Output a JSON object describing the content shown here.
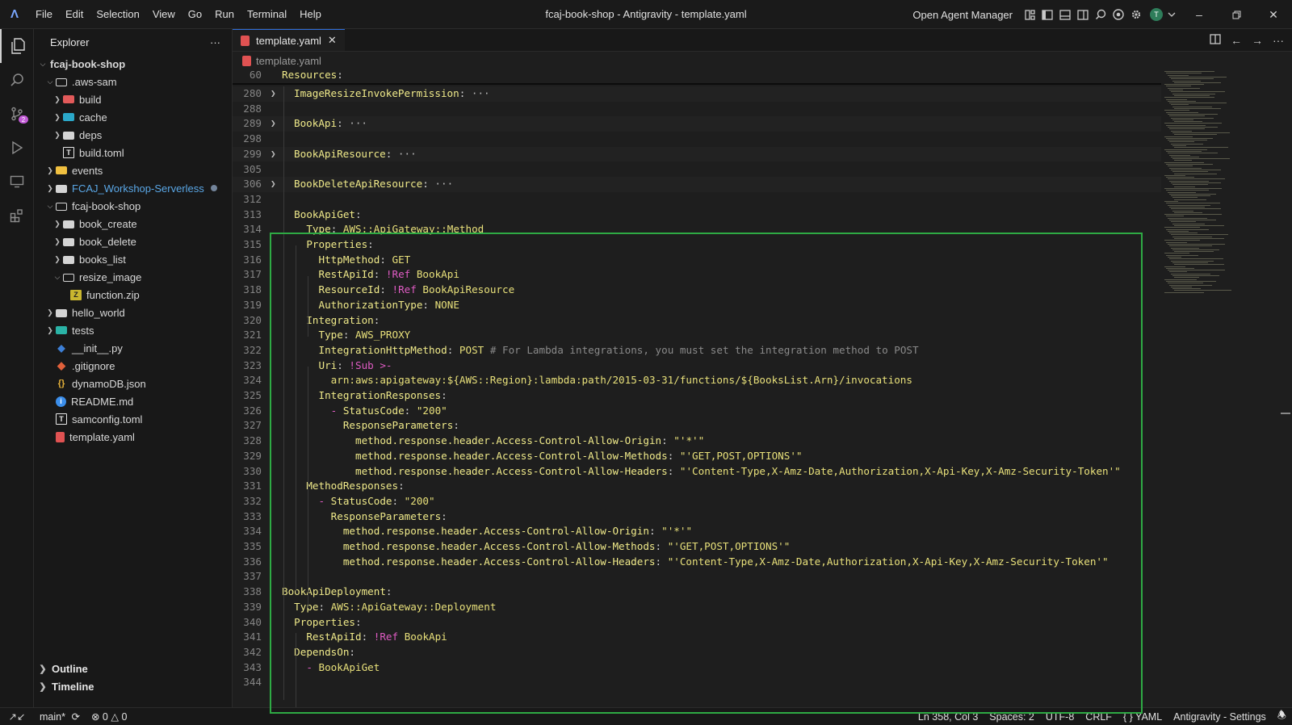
{
  "titlebar": {
    "menu": [
      "File",
      "Edit",
      "Selection",
      "View",
      "Go",
      "Run",
      "Terminal",
      "Help"
    ],
    "window_title": "fcaj-book-shop - Antigravity - template.yaml",
    "agent_manager": "Open Agent Manager",
    "avatar_initial": "T"
  },
  "activitybar": {
    "scm_badge": "2"
  },
  "sidebar": {
    "title": "Explorer",
    "more": "···",
    "tree": [
      {
        "label": "fcaj-book-shop",
        "depth": 0,
        "chevron": "open",
        "icon": "none",
        "bold": true
      },
      {
        "label": ".aws-sam",
        "depth": 1,
        "chevron": "open",
        "icon": "folder-open"
      },
      {
        "label": "build",
        "depth": 2,
        "chevron": "closed",
        "icon": "folder-build"
      },
      {
        "label": "cache",
        "depth": 2,
        "chevron": "closed",
        "icon": "folder-cache"
      },
      {
        "label": "deps",
        "depth": 2,
        "chevron": "closed",
        "icon": "folder"
      },
      {
        "label": "build.toml",
        "depth": 2,
        "chevron": "none",
        "icon": "toml"
      },
      {
        "label": "events",
        "depth": 1,
        "chevron": "closed",
        "icon": "folder-events"
      },
      {
        "label": "FCAJ_Workshop-Serverless",
        "depth": 1,
        "chevron": "closed",
        "icon": "folder",
        "color": "#5aa7e6",
        "dot": true
      },
      {
        "label": "fcaj-book-shop",
        "depth": 1,
        "chevron": "open",
        "icon": "folder-open"
      },
      {
        "label": "book_create",
        "depth": 2,
        "chevron": "closed",
        "icon": "folder"
      },
      {
        "label": "book_delete",
        "depth": 2,
        "chevron": "closed",
        "icon": "folder"
      },
      {
        "label": "books_list",
        "depth": 2,
        "chevron": "closed",
        "icon": "folder"
      },
      {
        "label": "resize_image",
        "depth": 2,
        "chevron": "open",
        "icon": "folder-open"
      },
      {
        "label": "function.zip",
        "depth": 3,
        "chevron": "none",
        "icon": "zip"
      },
      {
        "label": "hello_world",
        "depth": 1,
        "chevron": "closed",
        "icon": "folder"
      },
      {
        "label": "tests",
        "depth": 1,
        "chevron": "closed",
        "icon": "folder-tests"
      },
      {
        "label": "__init__.py",
        "depth": 1,
        "chevron": "none",
        "icon": "python"
      },
      {
        "label": ".gitignore",
        "depth": 1,
        "chevron": "none",
        "icon": "git"
      },
      {
        "label": "dynamoDB.json",
        "depth": 1,
        "chevron": "none",
        "icon": "json"
      },
      {
        "label": "README.md",
        "depth": 1,
        "chevron": "none",
        "icon": "info"
      },
      {
        "label": "samconfig.toml",
        "depth": 1,
        "chevron": "none",
        "icon": "toml"
      },
      {
        "label": "template.yaml",
        "depth": 1,
        "chevron": "none",
        "icon": "yaml"
      }
    ],
    "outline": "Outline",
    "timeline": "Timeline"
  },
  "editor": {
    "tab_label": "template.yaml",
    "breadcrumb": "template.yaml",
    "lines": [
      {
        "n": "60",
        "sticky": true,
        "tokens": [
          [
            "k",
            "Resources"
          ],
          [
            "p",
            ":"
          ]
        ]
      },
      {
        "n": "280",
        "folded": true,
        "tokens": [
          [
            "k",
            "ImageResizeInvokePermission"
          ],
          [
            "p",
            ":"
          ],
          [
            "dots",
            " ···"
          ]
        ]
      },
      {
        "n": "288",
        "tokens": []
      },
      {
        "n": "289",
        "folded": true,
        "tokens": [
          [
            "k",
            "BookApi"
          ],
          [
            "p",
            ":"
          ],
          [
            "dots",
            " ···"
          ]
        ]
      },
      {
        "n": "298",
        "tokens": []
      },
      {
        "n": "299",
        "folded": true,
        "tokens": [
          [
            "k",
            "BookApiResource"
          ],
          [
            "p",
            ":"
          ],
          [
            "dots",
            " ···"
          ]
        ]
      },
      {
        "n": "305",
        "tokens": []
      },
      {
        "n": "306",
        "folded": true,
        "tokens": [
          [
            "k",
            "BookDeleteApiResource"
          ],
          [
            "p",
            ":"
          ],
          [
            "dots",
            " ···"
          ]
        ]
      },
      {
        "n": "312",
        "tokens": []
      },
      {
        "n": "313",
        "tokens": [
          [
            "p",
            "  "
          ],
          [
            "k",
            "BookApiGet"
          ],
          [
            "p",
            ":"
          ]
        ]
      },
      {
        "n": "314",
        "tokens": [
          [
            "p",
            "    "
          ],
          [
            "k",
            "Type"
          ],
          [
            "p",
            ": "
          ],
          [
            "s",
            "AWS::ApiGateway::Method"
          ]
        ]
      },
      {
        "n": "315",
        "tokens": [
          [
            "p",
            "    "
          ],
          [
            "k",
            "Properties"
          ],
          [
            "p",
            ":"
          ]
        ]
      },
      {
        "n": "316",
        "tokens": [
          [
            "p",
            "      "
          ],
          [
            "k",
            "HttpMethod"
          ],
          [
            "p",
            ": "
          ],
          [
            "s",
            "GET"
          ]
        ]
      },
      {
        "n": "317",
        "tokens": [
          [
            "p",
            "      "
          ],
          [
            "k",
            "RestApiId"
          ],
          [
            "p",
            ": "
          ],
          [
            "t",
            "!Ref"
          ],
          [
            "s",
            " BookApi"
          ]
        ]
      },
      {
        "n": "318",
        "tokens": [
          [
            "p",
            "      "
          ],
          [
            "k",
            "ResourceId"
          ],
          [
            "p",
            ": "
          ],
          [
            "t",
            "!Ref"
          ],
          [
            "s",
            " BookApiResource"
          ]
        ]
      },
      {
        "n": "319",
        "tokens": [
          [
            "p",
            "      "
          ],
          [
            "k",
            "AuthorizationType"
          ],
          [
            "p",
            ": "
          ],
          [
            "s",
            "NONE"
          ]
        ]
      },
      {
        "n": "320",
        "tokens": [
          [
            "p",
            "    "
          ],
          [
            "k",
            "Integration"
          ],
          [
            "p",
            ":"
          ]
        ]
      },
      {
        "n": "321",
        "tokens": [
          [
            "p",
            "      "
          ],
          [
            "k",
            "Type"
          ],
          [
            "p",
            ": "
          ],
          [
            "s",
            "AWS_PROXY"
          ]
        ]
      },
      {
        "n": "322",
        "tokens": [
          [
            "p",
            "      "
          ],
          [
            "k",
            "IntegrationHttpMethod"
          ],
          [
            "p",
            ": "
          ],
          [
            "s",
            "POST"
          ],
          [
            "c",
            " # For Lambda integrations, you must set the integration method to POST"
          ]
        ]
      },
      {
        "n": "323",
        "tokens": [
          [
            "p",
            "      "
          ],
          [
            "k",
            "Uri"
          ],
          [
            "p",
            ": "
          ],
          [
            "t",
            "!Sub"
          ],
          [
            "t",
            " >-"
          ]
        ]
      },
      {
        "n": "324",
        "tokens": [
          [
            "p",
            "        "
          ],
          [
            "s",
            "arn:aws:apigateway:${AWS::Region}:lambda:path/2015-03-31/functions/${BooksList.Arn}/invocations"
          ]
        ]
      },
      {
        "n": "325",
        "tokens": [
          [
            "p",
            "      "
          ],
          [
            "k",
            "IntegrationResponses"
          ],
          [
            "p",
            ":"
          ]
        ]
      },
      {
        "n": "326",
        "tokens": [
          [
            "p",
            "        "
          ],
          [
            "t",
            "- "
          ],
          [
            "k",
            "StatusCode"
          ],
          [
            "p",
            ": "
          ],
          [
            "s",
            "\"200\""
          ]
        ]
      },
      {
        "n": "327",
        "tokens": [
          [
            "p",
            "          "
          ],
          [
            "k",
            "ResponseParameters"
          ],
          [
            "p",
            ":"
          ]
        ]
      },
      {
        "n": "328",
        "tokens": [
          [
            "p",
            "            "
          ],
          [
            "k",
            "method.response.header.Access-Control-Allow-Origin"
          ],
          [
            "p",
            ": "
          ],
          [
            "s",
            "\"'*'\""
          ]
        ]
      },
      {
        "n": "329",
        "tokens": [
          [
            "p",
            "            "
          ],
          [
            "k",
            "method.response.header.Access-Control-Allow-Methods"
          ],
          [
            "p",
            ": "
          ],
          [
            "s",
            "\"'GET,POST,OPTIONS'\""
          ]
        ]
      },
      {
        "n": "330",
        "tokens": [
          [
            "p",
            "            "
          ],
          [
            "k",
            "method.response.header.Access-Control-Allow-Headers"
          ],
          [
            "p",
            ": "
          ],
          [
            "s",
            "\"'Content-Type,X-Amz-Date,Authorization,X-Api-Key,X-Amz-Security-Token'\""
          ]
        ]
      },
      {
        "n": "331",
        "tokens": [
          [
            "p",
            "    "
          ],
          [
            "k",
            "MethodResponses"
          ],
          [
            "p",
            ":"
          ]
        ]
      },
      {
        "n": "332",
        "tokens": [
          [
            "p",
            "      "
          ],
          [
            "t",
            "- "
          ],
          [
            "k",
            "StatusCode"
          ],
          [
            "p",
            ": "
          ],
          [
            "s",
            "\"200\""
          ]
        ]
      },
      {
        "n": "333",
        "tokens": [
          [
            "p",
            "        "
          ],
          [
            "k",
            "ResponseParameters"
          ],
          [
            "p",
            ":"
          ]
        ]
      },
      {
        "n": "334",
        "tokens": [
          [
            "p",
            "          "
          ],
          [
            "k",
            "method.response.header.Access-Control-Allow-Origin"
          ],
          [
            "p",
            ": "
          ],
          [
            "s",
            "\"'*'\""
          ]
        ]
      },
      {
        "n": "335",
        "tokens": [
          [
            "p",
            "          "
          ],
          [
            "k",
            "method.response.header.Access-Control-Allow-Methods"
          ],
          [
            "p",
            ": "
          ],
          [
            "s",
            "\"'GET,POST,OPTIONS'\""
          ]
        ]
      },
      {
        "n": "336",
        "tokens": [
          [
            "p",
            "          "
          ],
          [
            "k",
            "method.response.header.Access-Control-Allow-Headers"
          ],
          [
            "p",
            ": "
          ],
          [
            "s",
            "\"'Content-Type,X-Amz-Date,Authorization,X-Api-Key,X-Amz-Security-Token'\""
          ]
        ]
      },
      {
        "n": "337",
        "tokens": []
      },
      {
        "n": "338",
        "tokens": [
          [
            "k",
            "BookApiDeployment"
          ],
          [
            "p",
            ":"
          ]
        ]
      },
      {
        "n": "339",
        "tokens": [
          [
            "p",
            "  "
          ],
          [
            "k",
            "Type"
          ],
          [
            "p",
            ": "
          ],
          [
            "s",
            "AWS::ApiGateway::Deployment"
          ]
        ]
      },
      {
        "n": "340",
        "tokens": [
          [
            "p",
            "  "
          ],
          [
            "k",
            "Properties"
          ],
          [
            "p",
            ":"
          ]
        ]
      },
      {
        "n": "341",
        "tokens": [
          [
            "p",
            "    "
          ],
          [
            "k",
            "RestApiId"
          ],
          [
            "p",
            ": "
          ],
          [
            "t",
            "!Ref"
          ],
          [
            "s",
            " BookApi"
          ]
        ]
      },
      {
        "n": "342",
        "tokens": [
          [
            "p",
            "  "
          ],
          [
            "k",
            "DependsOn"
          ],
          [
            "p",
            ":"
          ]
        ]
      },
      {
        "n": "343",
        "tokens": [
          [
            "p",
            "    "
          ],
          [
            "t",
            "- "
          ],
          [
            "s",
            "BookApiGet"
          ]
        ]
      },
      {
        "n": "344",
        "tokens": []
      }
    ]
  },
  "statusbar": {
    "branch": "main*",
    "errors": "0",
    "warnings": "0",
    "cursor": "Ln 358, Col 3",
    "spaces": "Spaces: 2",
    "encoding": "UTF-8",
    "eol": "CRLF",
    "language": "YAML",
    "settings": "Antigravity - Settings"
  },
  "colors": {
    "highlight_box": "#2eaa44",
    "key": "#f0ea8a",
    "tag": "#e05cc4",
    "comment": "#8a8a8a"
  }
}
